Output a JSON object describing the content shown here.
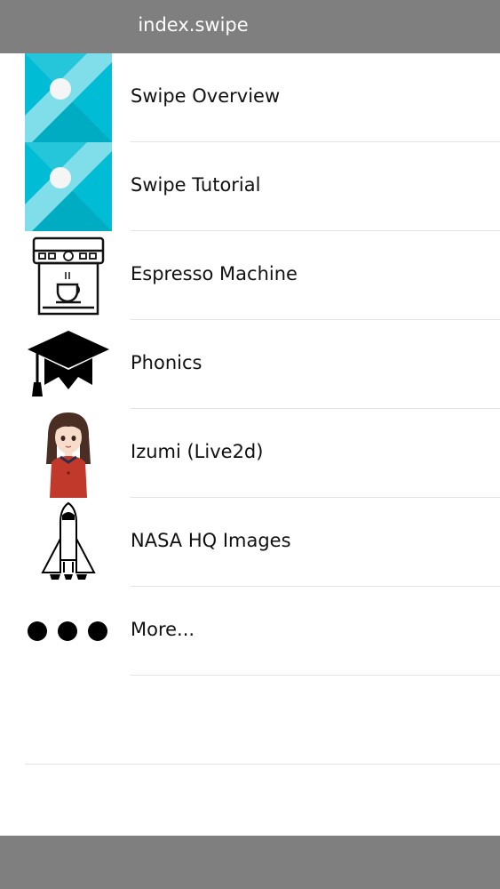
{
  "header": {
    "title": "index.swipe"
  },
  "list": {
    "items": [
      {
        "label": "Swipe Overview",
        "icon": "swipe-logo-icon"
      },
      {
        "label": "Swipe Tutorial",
        "icon": "swipe-logo-icon"
      },
      {
        "label": "Espresso Machine",
        "icon": "espresso-machine-icon"
      },
      {
        "label": "Phonics",
        "icon": "graduation-cap-icon"
      },
      {
        "label": "Izumi (Live2d)",
        "icon": "izumi-character-icon"
      },
      {
        "label": "NASA HQ Images",
        "icon": "space-shuttle-icon"
      },
      {
        "label": "More...",
        "icon": "more-dots-icon"
      }
    ]
  },
  "colors": {
    "bar": "#7f7f7f",
    "swipe_dark": "#00bcd4",
    "swipe_light": "#80deea",
    "separator": "#e3e3e3"
  }
}
